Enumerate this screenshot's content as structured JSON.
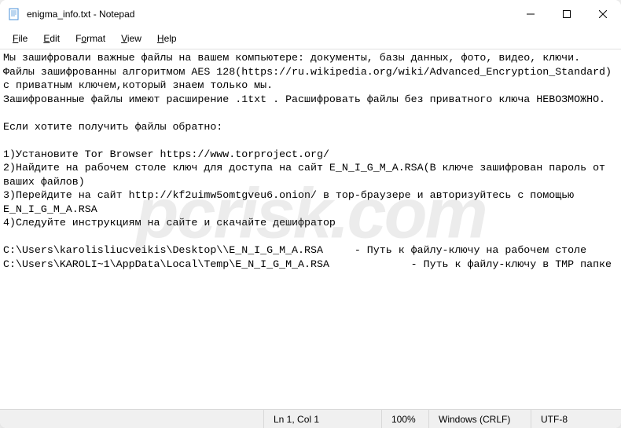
{
  "window": {
    "title": "enigma_info.txt - Notepad"
  },
  "menu": {
    "file": "File",
    "edit": "Edit",
    "format": "Format",
    "view": "View",
    "help": "Help"
  },
  "content": {
    "text": "Мы зашифровали важные файлы на вашем компьютере: документы, базы данных, фото, видео, ключи.\nФайлы зашифрованны алгоритмом AES 128(https://ru.wikipedia.org/wiki/Advanced_Encryption_Standard) c приватным ключем,который знаем только мы.\nЗашифрованные файлы имеют расширение .1txt . Расшифровать файлы без приватного ключа НЕВОЗМОЖНО.\n\nЕсли хотите получить файлы обратно:\n\n1)Установите Tor Browser https://www.torproject.org/\n2)Найдите на рабочем столе ключ для доступа на сайт E_N_I_G_M_A.RSA(В ключе зашифрован пароль от ваших файлов)\n3)Перейдите на сайт http://kf2uimw5omtgveu6.onion/ в тор-браузере и авторизуйтесь с помощью E_N_I_G_M_A.RSA\n4)Следуйте инструкциям на сайте и скачайте дешифратор\n\nC:\\Users\\karolisliucveikis\\Desktop\\\\E_N_I_G_M_A.RSA     - Путь к файлу-ключу на рабочем столе\nC:\\Users\\KAROLI~1\\AppData\\Local\\Temp\\E_N_I_G_M_A.RSA             - Путь к файлу-ключу в TMP папке"
  },
  "statusbar": {
    "position": "Ln 1, Col 1",
    "zoom": "100%",
    "eol": "Windows (CRLF)",
    "encoding": "UTF-8"
  },
  "watermark": "pcrisk.com"
}
